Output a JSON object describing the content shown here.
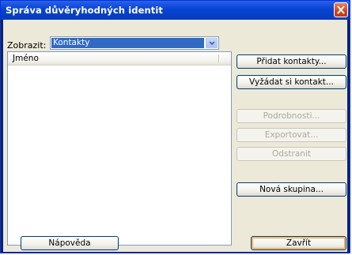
{
  "window": {
    "title": "Správa důvěryhodných identit",
    "close_icon": "close-icon"
  },
  "filter": {
    "label": "Zobrazit:",
    "selected": "Kontakty",
    "dropdown_icon": "chevron-down-icon"
  },
  "list": {
    "columns": [
      "Jméno"
    ],
    "rows": []
  },
  "buttons": {
    "add_contacts": "Přidat kontakty...",
    "request_contact": "Vyžádat si kontakt...",
    "details": "Podrobnosti...",
    "export": "Exportovat...",
    "remove": "Odstranit",
    "new_group": "Nová skupina...",
    "help": "Nápověda",
    "close": "Zavřít"
  },
  "colors": {
    "titlebar": "#0a46d6",
    "selection": "#316ac5",
    "dialog_background": "#ece9d8"
  }
}
